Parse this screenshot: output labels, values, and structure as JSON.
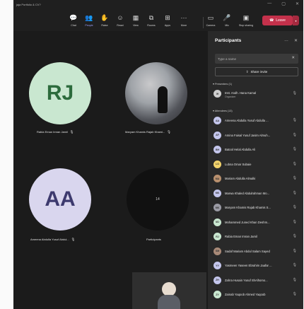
{
  "window": {
    "title": "jaja Portfolio & CV?",
    "controls": [
      "—",
      "▢",
      "✕"
    ]
  },
  "toolbar": {
    "items": [
      {
        "label": "Chat",
        "icon": "chat-icon",
        "glyph": "💬",
        "active": false
      },
      {
        "label": "People",
        "icon": "people-icon",
        "glyph": "👥",
        "active": true
      },
      {
        "label": "Raise",
        "icon": "raise-hand-icon",
        "glyph": "✋",
        "active": false
      },
      {
        "label": "React",
        "icon": "react-icon",
        "glyph": "☺",
        "active": false
      },
      {
        "label": "View",
        "icon": "view-icon",
        "glyph": "▦",
        "active": false
      },
      {
        "label": "Rooms",
        "icon": "rooms-icon",
        "glyph": "⧉",
        "active": false
      },
      {
        "label": "Apps",
        "icon": "apps-icon",
        "glyph": "⊞",
        "active": false
      },
      {
        "label": "More",
        "icon": "more-icon",
        "glyph": "···",
        "active": false
      },
      {
        "label": "Camera",
        "icon": "camera-icon",
        "glyph": "▭",
        "active": false
      },
      {
        "label": "Mic",
        "icon": "mic-icon",
        "glyph": "🎤",
        "active": false
      },
      {
        "label": "Stop sharing",
        "icon": "share-icon",
        "glyph": "▣",
        "active": false
      }
    ],
    "leave_label": "Leave",
    "leave_color": "#c4314b"
  },
  "stage": {
    "tiles": [
      {
        "initials": "RJ",
        "name": "Rabia Eman Imran Jamil"
      },
      {
        "initials": "",
        "name": "Maryam Khamis Rajab Khami..."
      },
      {
        "initials": "AA",
        "name": "Ameena Abdulla Yusuf Abdul..."
      },
      {
        "initials": "14",
        "name": "Participants"
      }
    ]
  },
  "panel": {
    "title": "Participants",
    "search_placeholder": "Type a name",
    "share_invite_label": "Share invite",
    "presenters_header": "Presenters (1)",
    "presenters": [
      {
        "name": "Inst. Andh. Hana Kamal",
        "role": "Organizer",
        "initials": "IH",
        "color": "#cfcfcf"
      }
    ],
    "attendees_header": "Attendees (13)",
    "attendees": [
      {
        "name": "Ameena Abdulla Yusuf Abdulla ...",
        "initials": "AA",
        "color": "#c4c6ec"
      },
      {
        "name": "Amina Faisal Yusuf Jasim Almuh...",
        "initials": "AF",
        "color": "#c4c6ec"
      },
      {
        "name": "Batool Helal Abdulla Ali",
        "initials": "BH",
        "color": "#c4c6ec"
      },
      {
        "name": "Lubna Omar Subaie",
        "initials": "LO",
        "color": "#f2d36b"
      },
      {
        "name": "Mariam Abdulla Almalki",
        "initials": "MA",
        "color": "#b9906e"
      },
      {
        "name": "Marwa Khaled Abdulrahman Mo...",
        "initials": "MK",
        "color": "#c4c6ec"
      },
      {
        "name": "Maryam Khamis Rajab Khamis S...",
        "initials": "MK",
        "color": "#9b9ba5"
      },
      {
        "name": "Mohammed Juned Khan Deshm...",
        "initials": "MJ",
        "color": "#c9e7d0"
      },
      {
        "name": "Rabia Eman Imran Jamil",
        "initials": "RJ",
        "color": "#c9e7d0"
      },
      {
        "name": "Sadaf Mariam Abdul Salam Sayed",
        "initials": "SM",
        "color": "#a98a78"
      },
      {
        "name": "Yasmeen Yaseen Ebrahim Jaafar ...",
        "initials": "YY",
        "color": "#c4c6ec"
      },
      {
        "name": "Zahra Husain Yusuf ShAlhomo...",
        "initials": "ZH",
        "color": "#c4c6ec"
      },
      {
        "name": "Zainab Yaqoob Ahmed Yaqoob",
        "initials": "ZY",
        "color": "#c9e7d0"
      }
    ]
  }
}
